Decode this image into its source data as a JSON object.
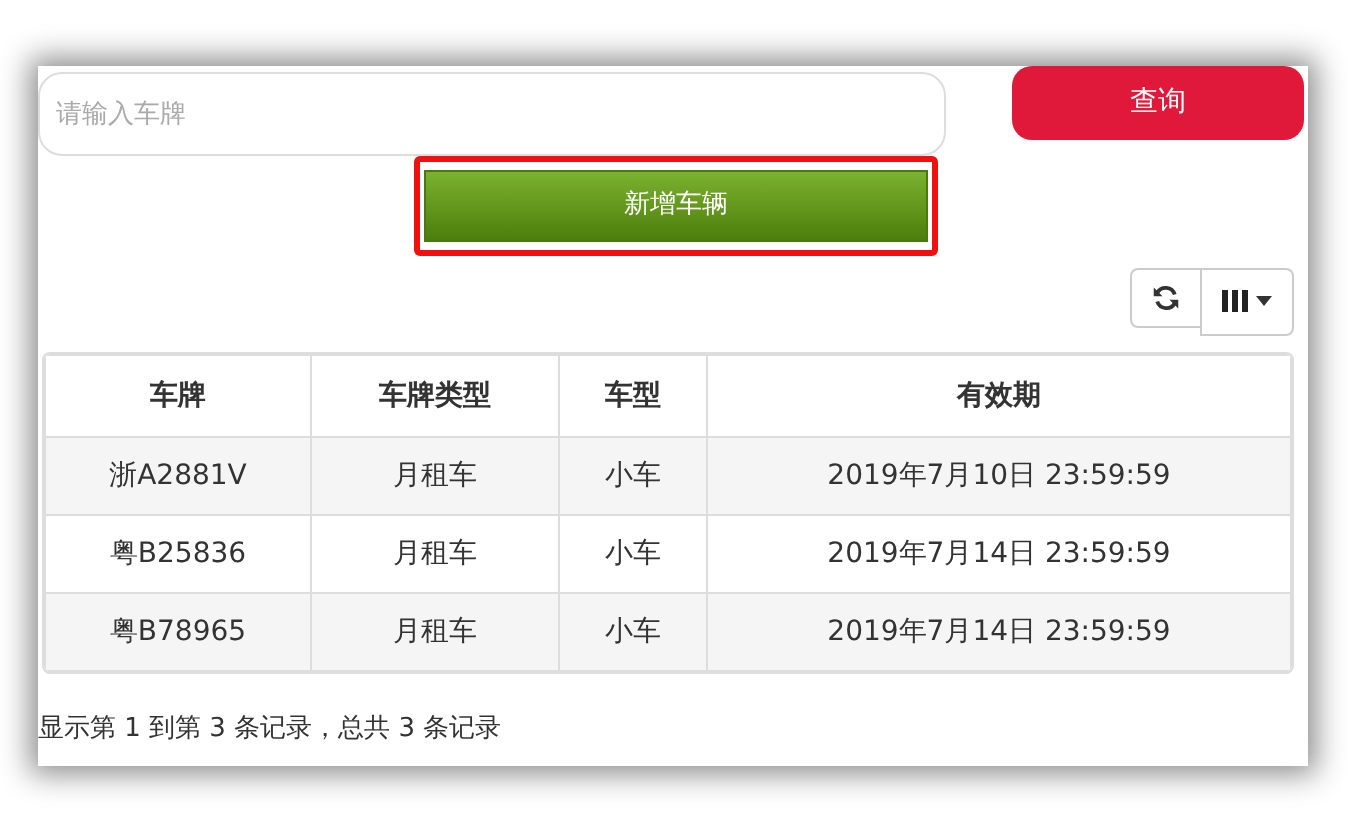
{
  "search": {
    "placeholder": "请输入车牌"
  },
  "search_button": "查询",
  "add_button": {
    "label": "新增车辆",
    "highlighted": true
  },
  "toolbar": {
    "refresh": true,
    "columns": true
  },
  "table": {
    "columns": [
      "车牌",
      "车牌类型",
      "车型",
      "有效期"
    ],
    "rows": [
      [
        "浙A2881V",
        "月租车",
        "小车",
        "2019年7月10日 23:59:59"
      ],
      [
        "粤B25836",
        "月租车",
        "小车",
        "2019年7月14日 23:59:59"
      ],
      [
        "粤B78965",
        "月租车",
        "小车",
        "2019年7月14日 23:59:59"
      ]
    ]
  },
  "footer": "显示第 1 到第 3 条记录，总共 3 条记录"
}
